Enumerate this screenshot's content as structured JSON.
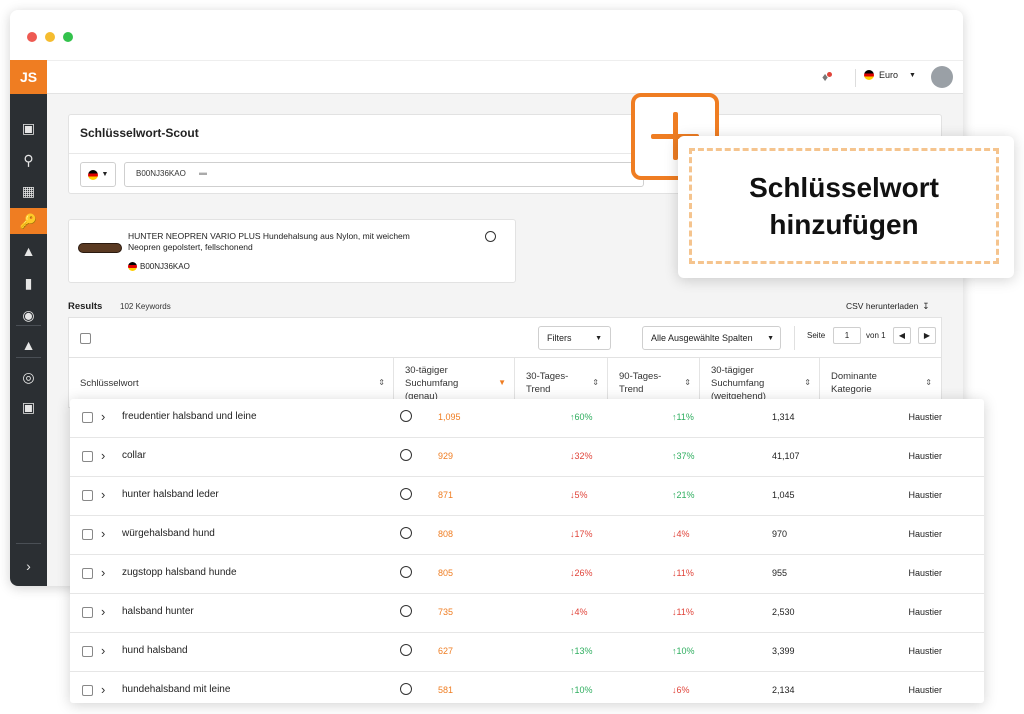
{
  "app": {
    "logo": "JS",
    "currency": "Euro",
    "title": "Schlüsselwort-Scout"
  },
  "search": {
    "asin_chip": "B00NJ36KAO"
  },
  "product": {
    "title": "HUNTER NEOPREN VARIO PLUS Hundehalsung aus Nylon, mit weichem Neopren gepolstert, fellschonend",
    "asin": "B00NJ36KAO"
  },
  "results": {
    "label": "Results",
    "count": "102 Keywords",
    "csv_label": "CSV herunterladen",
    "filters_label": "Filters",
    "columns_label": "Alle Ausgewählte Spalten",
    "page_label": "Seite",
    "page_value": "1",
    "page_of": "von 1"
  },
  "table": {
    "headers": [
      "Schlüsselwort",
      "30-tägiger Suchumfang (genau)",
      "30-Tages-Trend",
      "90-Tages-Trend",
      "30-tägiger Suchumfang (weitgehend)",
      "Dominante Kategorie"
    ],
    "rows": [
      {
        "keyword": "freudentier halsband und leine",
        "volume": "1,095",
        "trend30": "60%",
        "trend30_dir": "up",
        "trend90": "11%",
        "trend90_dir": "up",
        "broad": "1,314",
        "category": "Haustier"
      },
      {
        "keyword": "collar",
        "volume": "929",
        "trend30": "32%",
        "trend30_dir": "down",
        "trend90": "37%",
        "trend90_dir": "up",
        "broad": "41,107",
        "category": "Haustier"
      },
      {
        "keyword": "hunter halsband leder",
        "volume": "871",
        "trend30": "5%",
        "trend30_dir": "down",
        "trend90": "21%",
        "trend90_dir": "up",
        "broad": "1,045",
        "category": "Haustier"
      },
      {
        "keyword": "würgehalsband hund",
        "volume": "808",
        "trend30": "17%",
        "trend30_dir": "down",
        "trend90": "4%",
        "trend90_dir": "down",
        "broad": "970",
        "category": "Haustier"
      },
      {
        "keyword": "zugstopp halsband hunde",
        "volume": "805",
        "trend30": "26%",
        "trend30_dir": "down",
        "trend90": "11%",
        "trend90_dir": "down",
        "broad": "955",
        "category": "Haustier"
      },
      {
        "keyword": "halsband hunter",
        "volume": "735",
        "trend30": "4%",
        "trend30_dir": "down",
        "trend90": "11%",
        "trend90_dir": "down",
        "broad": "2,530",
        "category": "Haustier"
      },
      {
        "keyword": "hund halsband",
        "volume": "627",
        "trend30": "13%",
        "trend30_dir": "up",
        "trend90": "10%",
        "trend90_dir": "up",
        "broad": "3,399",
        "category": "Haustier"
      },
      {
        "keyword": "hundehalsband mit leine",
        "volume": "581",
        "trend30": "10%",
        "trend30_dir": "up",
        "trend90": "6%",
        "trend90_dir": "down",
        "broad": "2,134",
        "category": "Haustier"
      }
    ]
  },
  "callout": {
    "line1": "Schlüsselwort",
    "line2": "hinzufügen"
  },
  "colors": {
    "accent": "#ef7d22",
    "sidebar": "#2b2f33",
    "up": "#2fae5f",
    "down": "#e0443a"
  }
}
